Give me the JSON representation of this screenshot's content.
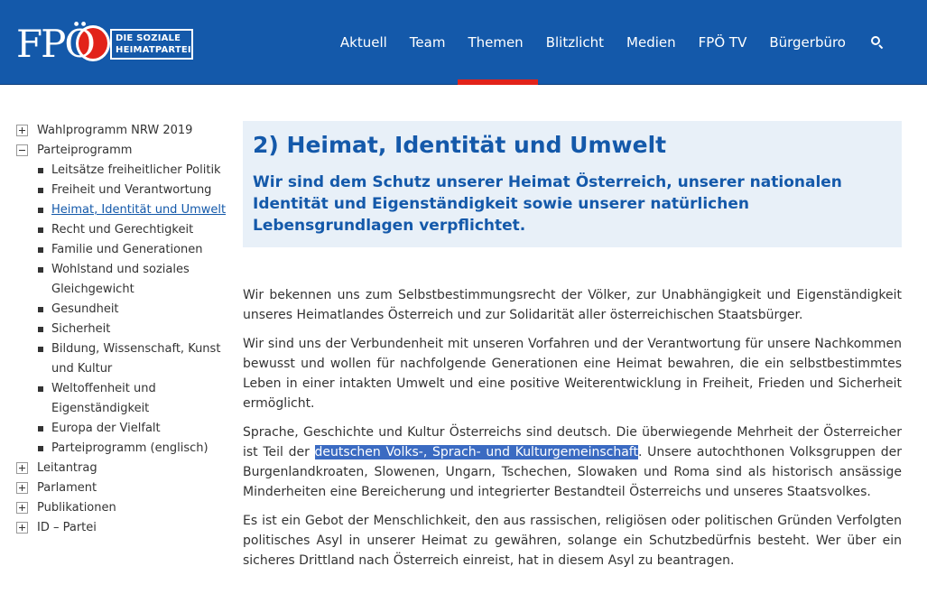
{
  "header": {
    "logo_text": "FPÖ",
    "logo_tagline_1": "DIE SOZIALE",
    "logo_tagline_2": "HEIMATPARTEI",
    "nav": [
      {
        "label": "Aktuell",
        "active": false
      },
      {
        "label": "Team",
        "active": false
      },
      {
        "label": "Themen",
        "active": true
      },
      {
        "label": "Blitzlicht",
        "active": false
      },
      {
        "label": "Medien",
        "active": false
      },
      {
        "label": "FPÖ TV",
        "active": false
      },
      {
        "label": "Bürgerbüro",
        "active": false
      }
    ],
    "search_icon": "search-icon"
  },
  "sidebar": {
    "top": [
      {
        "label": "Wahlprogramm NRW 2019",
        "expanded": false
      },
      {
        "label": "Parteiprogramm",
        "expanded": true
      }
    ],
    "sub": [
      "Leitsätze freiheitlicher Politik",
      "Freiheit und Verantwortung",
      "Heimat, Identität und Umwelt",
      "Recht und Gerechtigkeit",
      "Familie und Generationen",
      "Wohlstand und soziales Gleichgewicht",
      "Gesundheit",
      "Sicherheit",
      "Bildung, Wissenschaft, Kunst und Kultur",
      "Weltoffenheit und Eigenständigkeit",
      "Europa der Vielfalt",
      "Parteiprogramm (englisch)"
    ],
    "bottom": [
      {
        "label": "Leitantrag",
        "expanded": false
      },
      {
        "label": "Parlament",
        "expanded": false
      },
      {
        "label": "Publikationen",
        "expanded": false
      },
      {
        "label": "ID – Partei",
        "expanded": false
      }
    ]
  },
  "main": {
    "title": "2) Heimat, Identität und Umwelt",
    "subtitle": "Wir sind dem Schutz unserer Heimat Österreich, unserer nationalen Identität und Eigenständigkeit sowie unserer natürlichen Lebensgrundlagen verpflichtet.",
    "p1": "Wir bekennen uns zum Selbstbestimmungsrecht der Völker, zur Unabhängigkeit und Eigenständigkeit unseres Heimatlandes Österreich und zur Solidarität aller österreichischen Staatsbürger.",
    "p2": "Wir sind uns der Verbundenheit mit unseren Vorfahren und der Verantwortung für unsere Nachkommen bewusst und wollen für nachfolgende Generationen eine Heimat bewahren, die ein selbstbestimmtes Leben in einer intakten Umwelt und eine positive Weiterentwicklung in Freiheit, Frieden und Sicherheit ermöglicht.",
    "p3_before": "Sprache, Geschichte und Kultur Österreichs sind deutsch. Die überwiegende Mehrheit der Österreicher ist Teil der ",
    "p3_highlight": "deutschen Volks-, Sprach- und Kulturgemeinschaft",
    "p3_after": ". Unsere autochthonen Volksgruppen der Burgenlandkroaten, Slowenen, Ungarn, Tschechen, Slowaken und Roma sind als historisch ansässige Minderheiten eine Bereicherung und integrierter Bestandteil Österreichs und unseres Staatsvolkes.",
    "p4": "Es ist ein Gebot der Menschlichkeit, den aus rassischen, religiösen oder politischen Gründen Verfolgten politisches Asyl in unserer Heimat zu gewähren, solange ein Schutzbedürfnis besteht. Wer über ein sicheres Drittland nach Österreich einreist, hat in diesem Asyl zu beantragen."
  },
  "colors": {
    "header_bg": "#1459aa",
    "accent_red": "#e2231a",
    "headline_bg": "#e8f0f8",
    "selection": "#3b6bc2"
  }
}
